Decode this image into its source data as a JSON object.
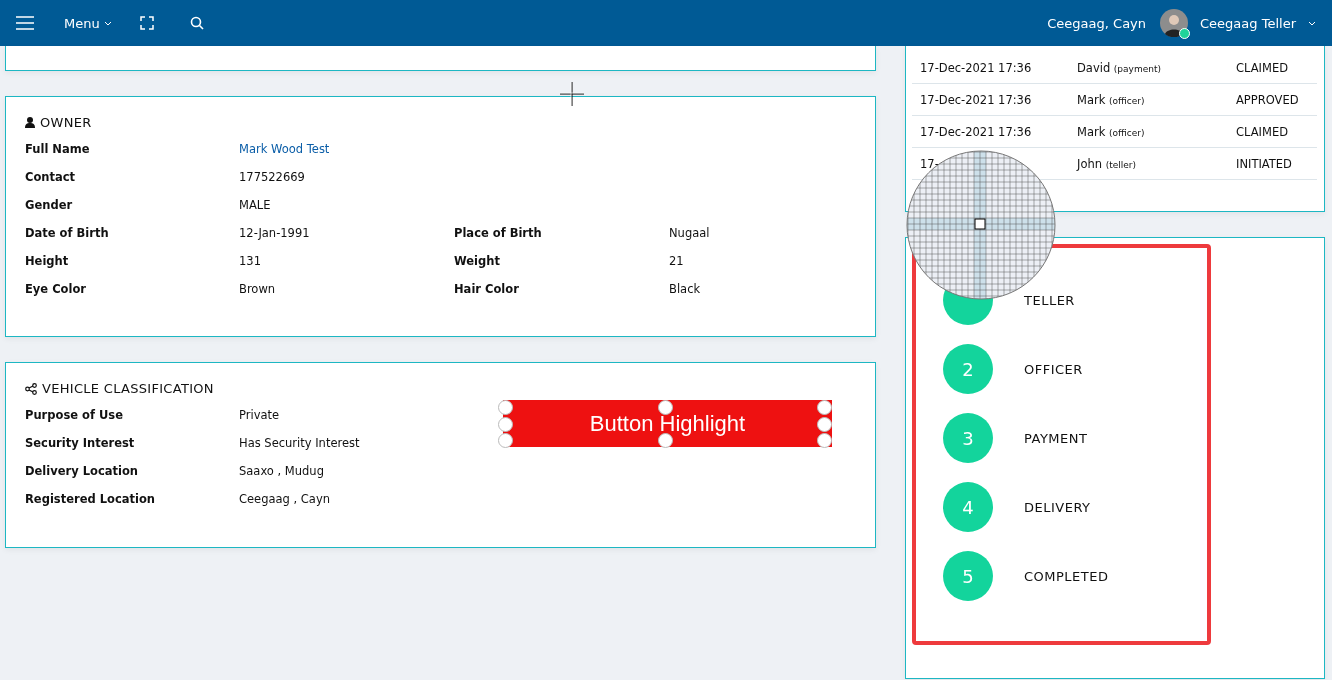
{
  "topbar": {
    "menu_label": "Menu",
    "user_location": "Ceegaag, Cayn",
    "user_name": "Ceegaag Teller",
    "online": true
  },
  "owner": {
    "title": "OWNER",
    "fields": [
      {
        "label": "Full Name",
        "value": "Mark Wood Test",
        "kind": "link"
      },
      {
        "label": "Contact",
        "value": "177522669",
        "kind": "text"
      },
      {
        "label": "Gender",
        "value": "MALE",
        "kind": "text"
      },
      {
        "label": "Date of Birth",
        "value": "12-Jan-1991",
        "kind": "text",
        "label_2": "Place of Birth",
        "value_2": "Nugaal"
      },
      {
        "label": "Height",
        "value": "131",
        "kind": "text",
        "label_2": "Weight",
        "value_2": "21"
      },
      {
        "label": "Eye Color",
        "value": "Brown",
        "kind": "text",
        "label_2": "Hair Color",
        "value_2": "Black"
      }
    ]
  },
  "vehicle_classification": {
    "title": "VEHICLE CLASSIFICATION",
    "fields": [
      {
        "label": "Purpose of Use",
        "value": "Private"
      },
      {
        "label": "Security Interest",
        "value": "Has Security Interest"
      },
      {
        "label": "Delivery Location",
        "value": "Saaxo , Mudug"
      },
      {
        "label": "Registered Location",
        "value": "Ceegaag , Cayn"
      }
    ]
  },
  "history": {
    "rows": [
      {
        "date": "17-Dec-2021 17:36",
        "user": "David",
        "role": "(payment)",
        "status": "CLAIMED"
      },
      {
        "date": "17-Dec-2021 17:36",
        "user": "Mark",
        "role": "(officer)",
        "status": "APPROVED"
      },
      {
        "date": "17-Dec-2021 17:36",
        "user": "Mark",
        "role": "(officer)",
        "status": "CLAIMED"
      },
      {
        "date": "17-",
        "user": "John",
        "role": "(teller)",
        "status": "INITIATED"
      }
    ]
  },
  "steps": [
    {
      "label": "TELLER"
    },
    {
      "number": "2",
      "label": "OFFICER"
    },
    {
      "number": "3",
      "label": "PAYMENT"
    },
    {
      "number": "4",
      "label": "DELIVERY"
    },
    {
      "number": "5",
      "label": "COMPLETED"
    }
  ],
  "annotation": {
    "label": "Button Highlight"
  }
}
